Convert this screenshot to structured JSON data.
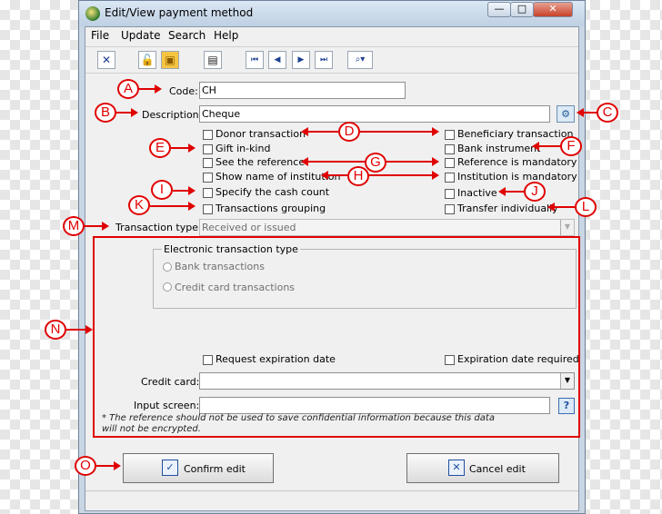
{
  "window": {
    "title": "Edit/View payment method",
    "minimize_glyph": "—",
    "maximize_glyph": "□",
    "close_glyph": "✕"
  },
  "menu": [
    "File",
    "Update",
    "Search",
    "Help"
  ],
  "toolbar_icons": [
    "close-x-icon",
    "unlock-icon",
    "save-disk-icon",
    "print-icon",
    "first-record-icon",
    "previous-record-icon",
    "next-record-icon",
    "last-record-icon",
    "search-options-icon"
  ],
  "toolbar_glyphs": {
    "close": "✕",
    "unlock": "🔓",
    "save": "▣",
    "print": "▤",
    "first": "⏮",
    "prev": "◀",
    "next": "▶",
    "last": "⏭",
    "search": "⌕▾"
  },
  "form": {
    "code_label": "Code:",
    "code_value": "CH",
    "description_label": "Description:",
    "description_value": "Cheque",
    "translate_glyph": "⚙",
    "checkboxes_left": [
      "Donor transaction",
      "Gift in-kind",
      "See the reference",
      "Show name of institution",
      "Specify the cash count",
      "Transactions grouping"
    ],
    "checkboxes_right": [
      "Beneficiary transaction",
      "Bank instrument",
      "Reference is mandatory",
      "Institution is mandatory",
      "Inactive",
      "Transfer individually"
    ],
    "transaction_type_label": "Transaction type:",
    "transaction_type_value": "Received or issued",
    "electronic_group_title": "Electronic transaction type",
    "radio_options": [
      "Bank transactions",
      "Credit card transactions"
    ],
    "request_expiration": "Request expiration date",
    "expiration_required": "Expiration date required",
    "credit_card_label": "Credit card:",
    "input_screen_label": "Input screen:",
    "help_glyph": "?",
    "note": "* The reference should not be used to save confidential information because this data will not be encrypted.",
    "confirm_label": "Confirm edit",
    "cancel_label": "Cancel edit",
    "confirm_glyph": "✓",
    "cancel_glyph": "✕"
  },
  "callouts": [
    "A",
    "B",
    "C",
    "D",
    "E",
    "F",
    "G",
    "H",
    "I",
    "J",
    "K",
    "L",
    "M",
    "N",
    "O"
  ],
  "annotation_color": "#e00000"
}
